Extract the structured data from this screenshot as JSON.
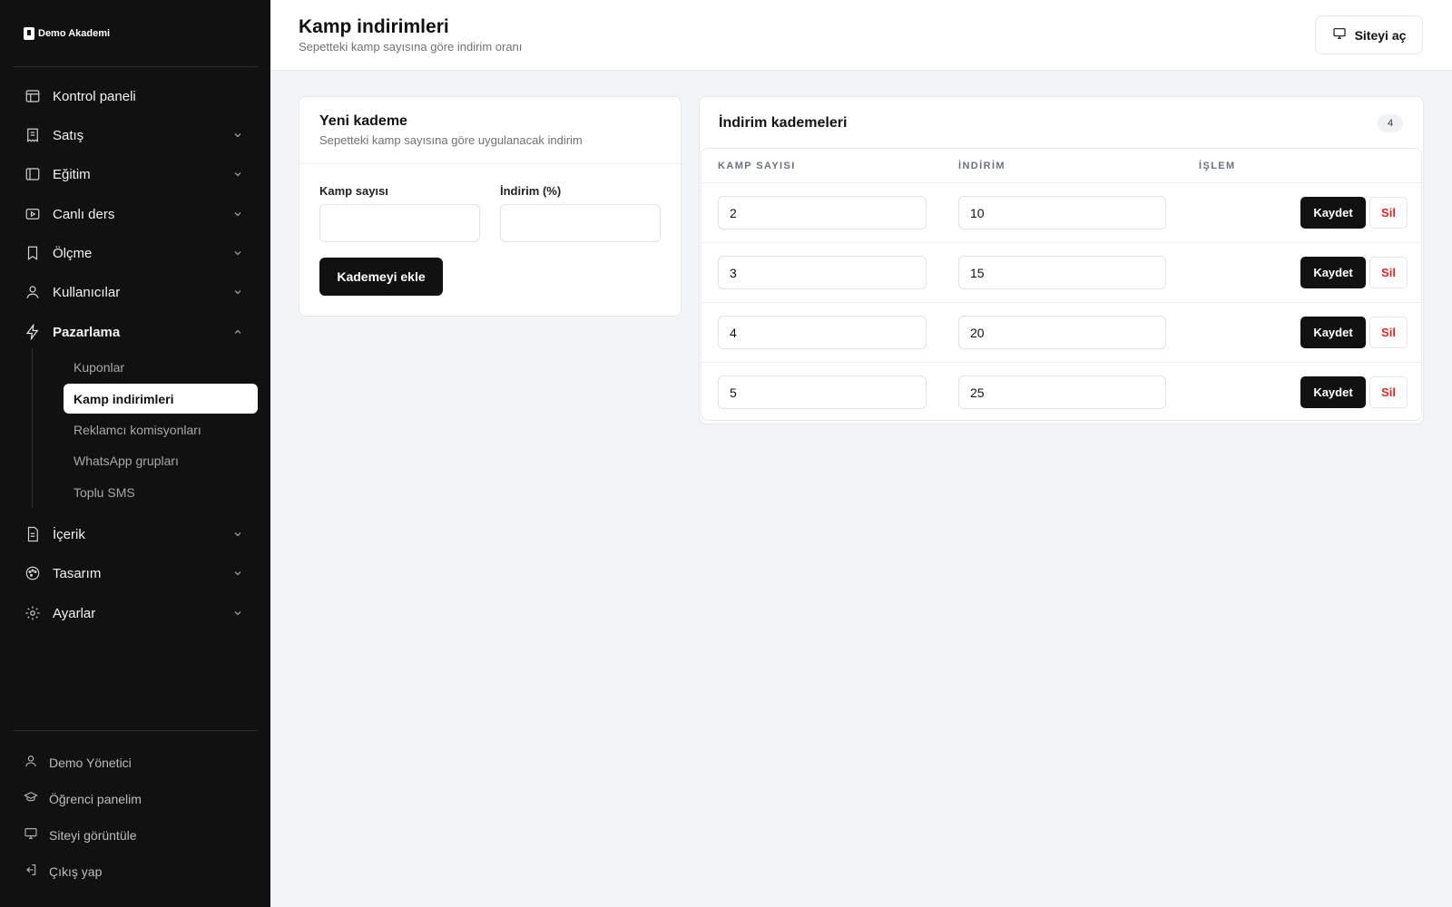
{
  "brand": {
    "name": "Demo Akademi"
  },
  "sidebar": {
    "items": [
      {
        "label": "Kontrol paneli",
        "icon": "layout-icon"
      },
      {
        "label": "Satış",
        "icon": "receipt-icon"
      },
      {
        "label": "Eğitim",
        "icon": "book-icon"
      },
      {
        "label": "Canlı ders",
        "icon": "video-icon"
      },
      {
        "label": "Ölçme",
        "icon": "bookmark-icon"
      },
      {
        "label": "Kullanıcılar",
        "icon": "user-icon"
      },
      {
        "label": "Pazarlama",
        "icon": "zap-icon",
        "expanded": true
      },
      {
        "label": "İçerik",
        "icon": "file-icon"
      },
      {
        "label": "Tasarım",
        "icon": "palette-icon"
      },
      {
        "label": "Ayarlar",
        "icon": "gear-icon"
      }
    ],
    "subitems": [
      {
        "label": "Kuponlar"
      },
      {
        "label": "Kamp indirimleri",
        "active": true
      },
      {
        "label": "Reklamcı komisyonları"
      },
      {
        "label": "WhatsApp grupları"
      },
      {
        "label": "Toplu SMS"
      }
    ],
    "footer": [
      {
        "label": "Demo Yönetici",
        "icon": "user-icon"
      },
      {
        "label": "Öğrenci panelim",
        "icon": "graduation-cap-icon"
      },
      {
        "label": "Siteyi görüntüle",
        "icon": "monitor-icon"
      },
      {
        "label": "Çıkış yap",
        "icon": "logout-icon"
      }
    ]
  },
  "header": {
    "title": "Kamp indirimleri",
    "subtitle": "Sepetteki kamp sayısına göre indirim oranı",
    "open_site_label": "Siteyi aç"
  },
  "new_tier": {
    "title": "Yeni kademe",
    "subtitle": "Sepetteki kamp sayısına göre uygulanacak indirim",
    "camp_count_label": "Kamp sayısı",
    "camp_count_value": "",
    "discount_label": "İndirim (%)",
    "discount_value": "",
    "add_label": "Kademeyi ekle"
  },
  "tiers": {
    "title": "İndirim kademeleri",
    "count": "4",
    "columns": [
      "KAMP SAYISI",
      "İNDİRİM",
      "İŞLEM"
    ],
    "save_label": "Kaydet",
    "delete_label": "Sil",
    "rows": [
      {
        "camp_count": "2",
        "discount": "10"
      },
      {
        "camp_count": "3",
        "discount": "15"
      },
      {
        "camp_count": "4",
        "discount": "20"
      },
      {
        "camp_count": "5",
        "discount": "25"
      }
    ]
  },
  "colors": {
    "sidebar_bg": "#111111",
    "primary": "#111111",
    "danger": "#dc2626",
    "page_bg": "#f3f4f6"
  }
}
